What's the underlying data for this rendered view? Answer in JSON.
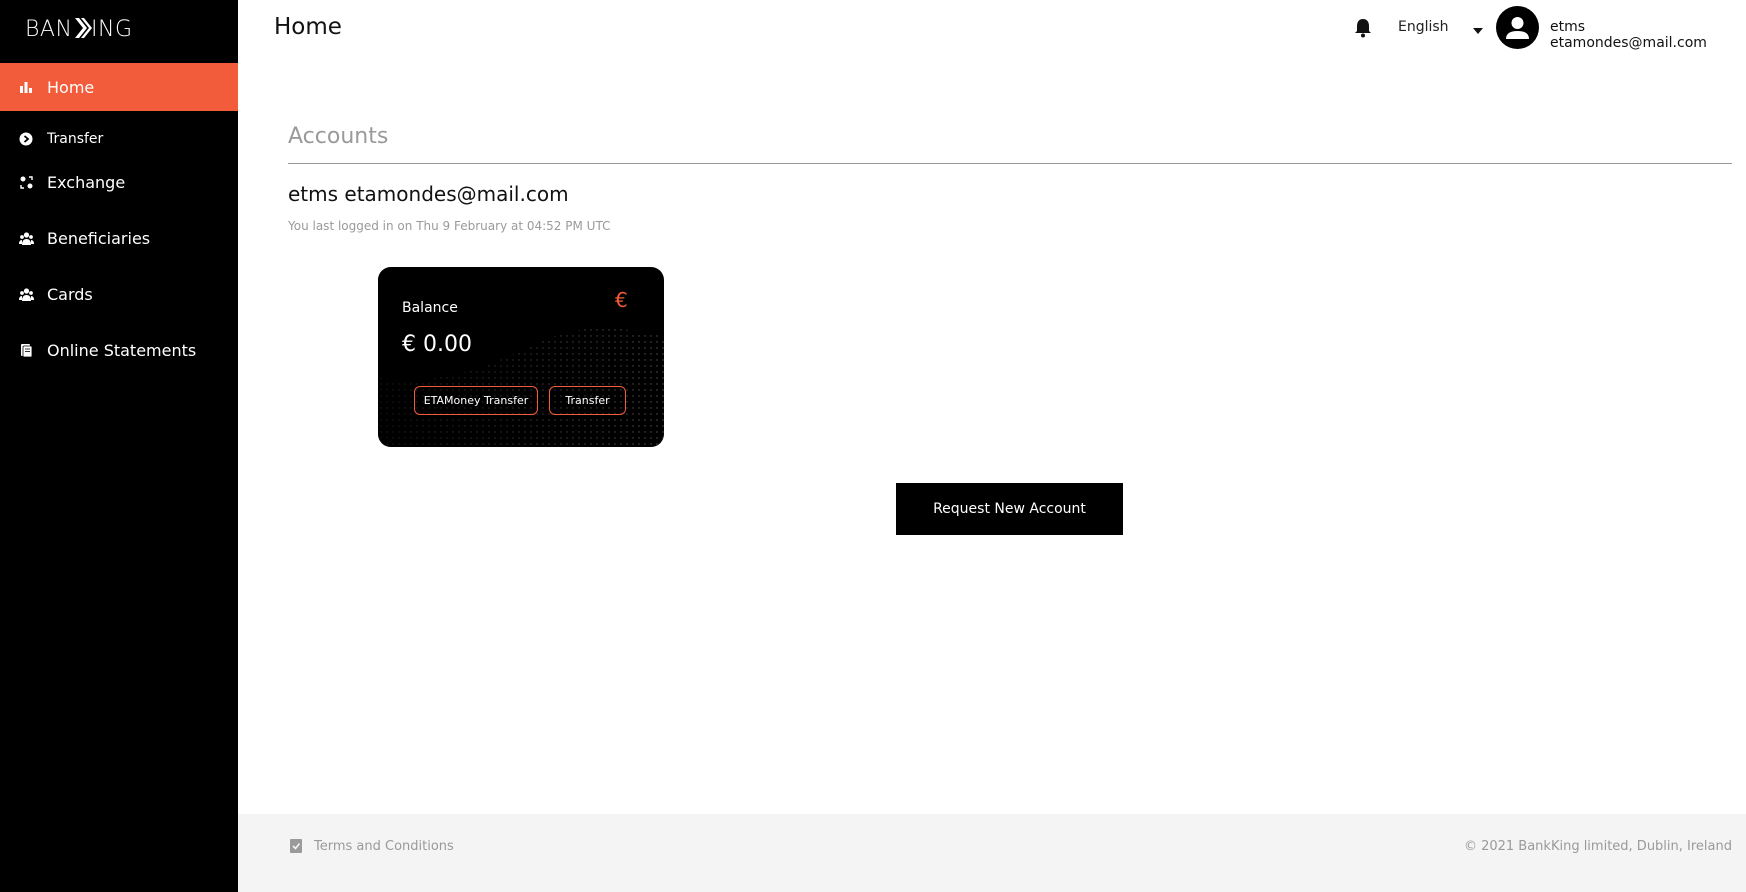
{
  "brand": {
    "logo_text": "BANKING",
    "accent": "#f25c3b"
  },
  "sidebar": {
    "items": [
      {
        "label": "Home",
        "icon": "bar-chart-icon",
        "active": true
      },
      {
        "label": "Transfer",
        "icon": "arrow-circle-icon",
        "active": false
      },
      {
        "label": "Exchange",
        "icon": "exchange-icon",
        "active": false
      },
      {
        "label": "Beneficiaries",
        "icon": "people-icon",
        "active": false
      },
      {
        "label": "Cards",
        "icon": "people-icon",
        "active": false
      },
      {
        "label": "Online Statements",
        "icon": "document-icon",
        "active": false
      }
    ]
  },
  "header": {
    "title": "Home",
    "language": "English",
    "user_name": "etms etamondes@mail.com"
  },
  "accounts": {
    "section_title": "Accounts",
    "account_name": "etms etamondes@mail.com",
    "last_login": "You last logged in on Thu 9 February at 04:52 PM UTC",
    "card": {
      "label": "Balance",
      "currency_symbol": "€",
      "amount": "€ 0.00",
      "etamoney_transfer_label": "ETAMoney Transfer",
      "transfer_label": "Transfer"
    },
    "request_button": "Request New Account"
  },
  "footer": {
    "terms": "Terms and Conditions",
    "copyright": "© 2021 BankKing limited, Dublin, Ireland"
  }
}
